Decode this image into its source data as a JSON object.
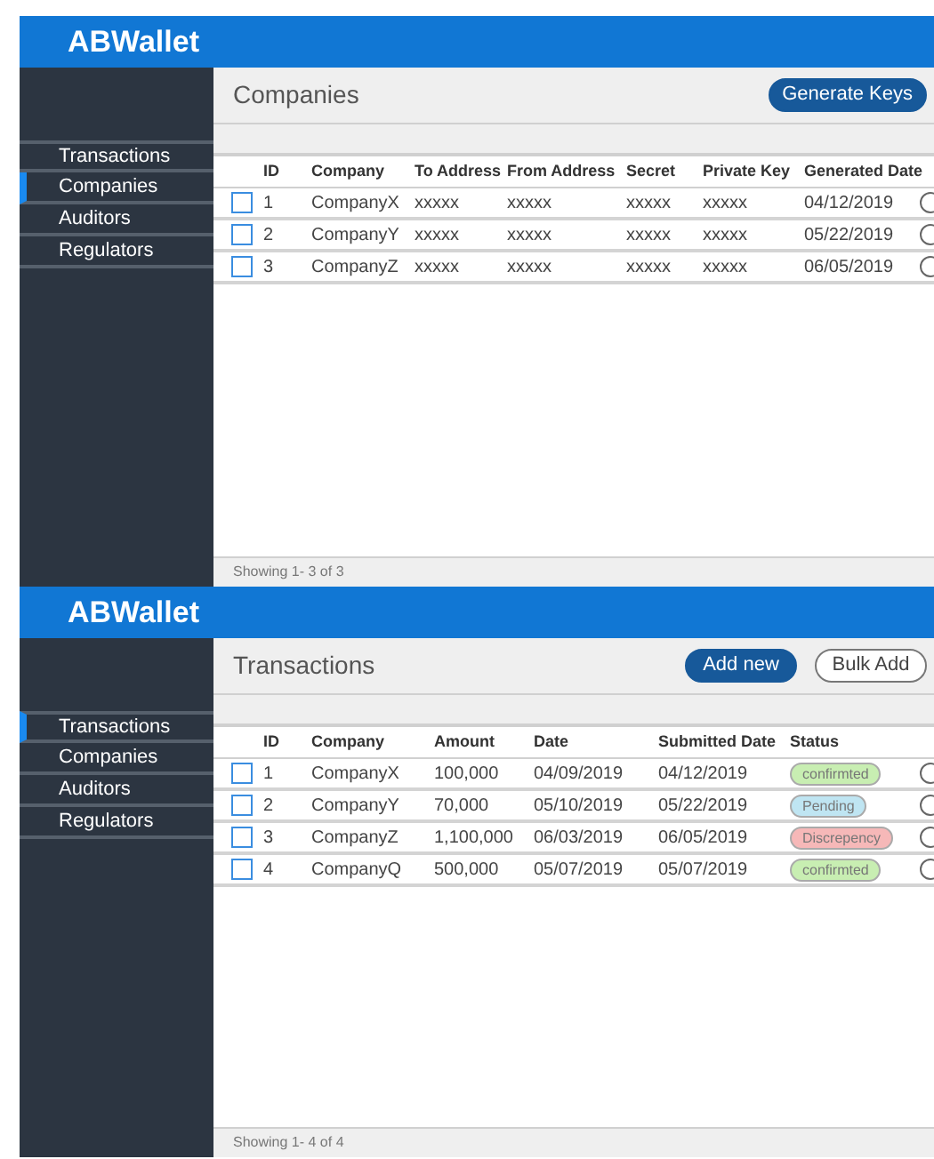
{
  "screens": [
    {
      "app_title": "ABWallet",
      "sidebar": {
        "items": [
          {
            "label": "Transactions",
            "selected": false
          },
          {
            "label": "Companies",
            "selected": true
          },
          {
            "label": "Auditors",
            "selected": false
          },
          {
            "label": "Regulators",
            "selected": false
          }
        ]
      },
      "page_title": "Companies",
      "buttons": [
        {
          "label": "Generate Keys",
          "kind": "primary"
        }
      ],
      "table": {
        "kind": "companies",
        "columns": [
          "ID",
          "Company",
          "To Address",
          "From Address",
          "Secret",
          "Private Key",
          "Generated Date"
        ],
        "rows": [
          {
            "checked": false,
            "cells": [
              "1",
              "CompanyX",
              "xxxxx",
              "xxxxx",
              "xxxxx",
              "xxxxx",
              "04/12/2019"
            ]
          },
          {
            "checked": false,
            "cells": [
              "2",
              "CompanyY",
              "xxxxx",
              "xxxxx",
              "xxxxx",
              "xxxxx",
              "05/22/2019"
            ]
          },
          {
            "checked": false,
            "cells": [
              "3",
              "CompanyZ",
              "xxxxx",
              "xxxxx",
              "xxxxx",
              "xxxxx",
              "06/05/2019"
            ]
          }
        ]
      },
      "footer": "Showing 1- 3 of 3"
    },
    {
      "app_title": "ABWallet",
      "sidebar": {
        "items": [
          {
            "label": "Transactions",
            "selected": true
          },
          {
            "label": "Companies",
            "selected": false
          },
          {
            "label": "Auditors",
            "selected": false
          },
          {
            "label": "Regulators",
            "selected": false
          }
        ]
      },
      "page_title": "Transactions",
      "buttons": [
        {
          "label": "Add new",
          "kind": "primary"
        },
        {
          "label": "Bulk Add",
          "kind": "outline"
        }
      ],
      "table": {
        "kind": "transactions",
        "columns": [
          "ID",
          "Company",
          "Amount",
          "Date",
          "Submitted Date",
          "Status"
        ],
        "rows": [
          {
            "checked": false,
            "cells": [
              "1",
              "CompanyX",
              "100,000",
              "04/09/2019",
              "04/12/2019"
            ],
            "status": {
              "label": "confirmted",
              "color": "#c8eeb2"
            }
          },
          {
            "checked": false,
            "cells": [
              "2",
              "CompanyY",
              "70,000",
              "05/10/2019",
              "05/22/2019"
            ],
            "status": {
              "label": "Pending",
              "color": "#bfe5f2"
            }
          },
          {
            "checked": false,
            "cells": [
              "3",
              "CompanyZ",
              "1,100,000",
              "06/03/2019",
              "06/05/2019"
            ],
            "status": {
              "label": "Discrepency",
              "color": "#f6b8b8"
            }
          },
          {
            "checked": false,
            "cells": [
              "4",
              "CompanyQ",
              "500,000",
              "05/07/2019",
              "05/07/2019"
            ],
            "status": {
              "label": "confirmted",
              "color": "#c8eeb2"
            }
          }
        ]
      },
      "footer": "Showing 1- 4 of 4"
    }
  ]
}
